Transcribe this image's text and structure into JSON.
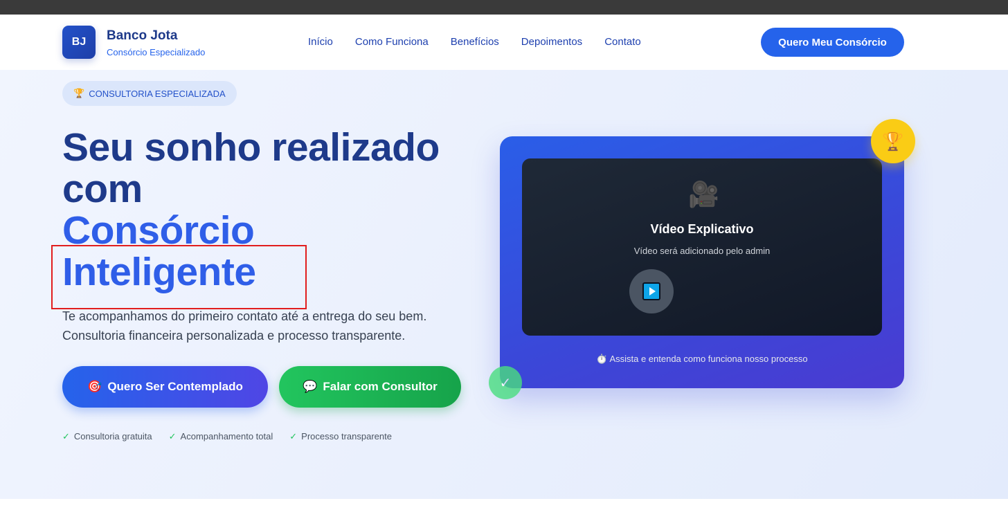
{
  "header": {
    "logo_initials": "BJ",
    "brand_name": "Banco Jota",
    "brand_subtitle": "Consórcio Especializado",
    "nav": [
      "Início",
      "Como Funciona",
      "Benefícios",
      "Depoimentos",
      "Contato"
    ],
    "cta_label": "Quero Meu Consórcio"
  },
  "hero": {
    "badge_icon": "🏆",
    "badge_label": "CONSULTORIA ESPECIALIZADA",
    "headline_line1": "Seu sonho realizado",
    "headline_line2": "com",
    "headline_line3": "Consórcio",
    "headline_line4": "Inteligente",
    "description_line1": "Te acompanhamos do primeiro contato até a entrega do seu bem.",
    "description_line2": "Consultoria financeira personalizada e processo transparente.",
    "primary_button_icon": "🎯",
    "primary_button_label": "Quero Ser Contemplado",
    "secondary_button_icon": "💬",
    "secondary_button_label": "Falar com Consultor",
    "checks": [
      "Consultoria gratuita",
      "Acompanhamento total",
      "Processo transparente"
    ]
  },
  "video": {
    "camera_icon": "🎥",
    "title": "Vídeo Explicativo",
    "subtitle": "Vídeo será adicionado pelo admin",
    "caption": "⏱️ Assista e entenda como funciona nosso processo",
    "trophy_icon": "🏆",
    "check_icon": "✓"
  },
  "colors": {
    "primary": "#2563eb",
    "navy": "#1e3a8a",
    "green": "#22c55e",
    "gold": "#facc15",
    "highlight_border": "#e11d1d"
  }
}
